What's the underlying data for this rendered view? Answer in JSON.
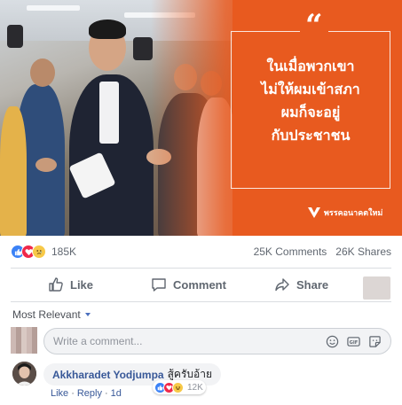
{
  "post": {
    "image": {
      "quote_mark": "“",
      "quote_lines": [
        "ในเมื่อพวกเขา",
        "ไม่ให้ผมเข้าสภา",
        "ผมก็จะอยู่",
        "กับประชาชน"
      ],
      "party_name": "พรรคอนาคตใหม่",
      "colors": {
        "orange": "#e85a1f",
        "white": "#ffffff"
      }
    },
    "reactions": {
      "icons": [
        "like-icon",
        "love-icon",
        "sad-icon"
      ],
      "count": "185K",
      "comments": "25K Comments",
      "shares": "26K Shares"
    },
    "actions": {
      "like": "Like",
      "comment": "Comment",
      "share": "Share"
    }
  },
  "comments_section": {
    "sort_label": "Most Relevant",
    "input_placeholder": "Write a comment...",
    "input_icons": [
      "emoji-icon",
      "gif-icon",
      "sticker-icon"
    ],
    "comments": [
      {
        "author": "Akkharadet Yodjumpa",
        "text": "สู้ครับอ้าย",
        "reaction_count": "12K",
        "reaction_icons": [
          "like-icon",
          "love-icon",
          "haha-icon"
        ],
        "actions": {
          "like": "Like",
          "reply": "Reply",
          "time": "1d",
          "separator": "·"
        }
      }
    ]
  },
  "colors": {
    "link_blue": "#385898",
    "facebook_blue": "#4b6fbd",
    "gray_text": "#606770",
    "divider": "#dadde1"
  }
}
